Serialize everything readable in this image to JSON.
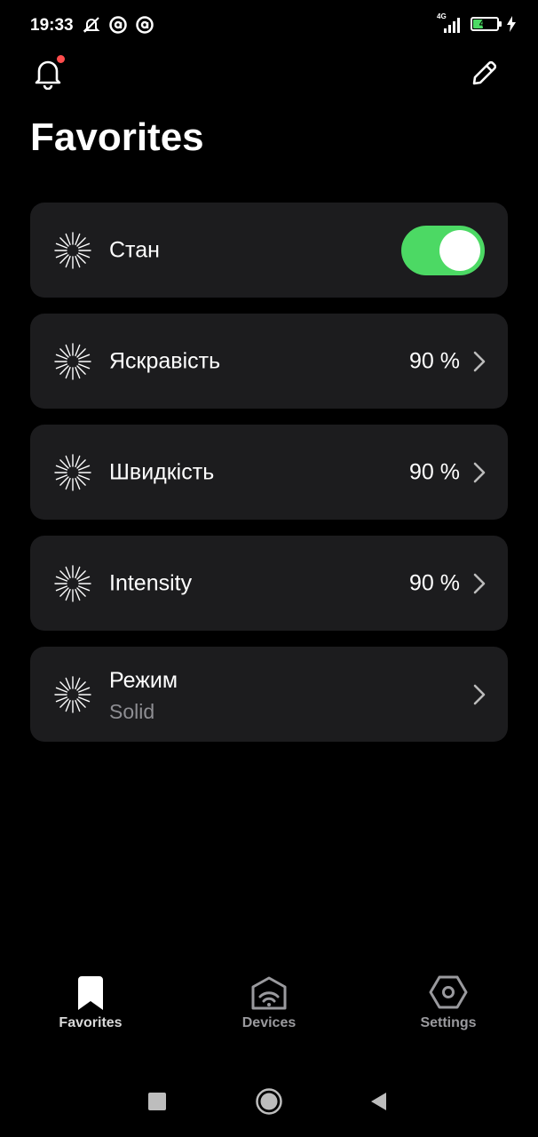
{
  "status_bar": {
    "time": "19:33",
    "network": "4G",
    "battery_level": "41",
    "battery_fill_fraction": 0.41
  },
  "header": {
    "title": "Favorites",
    "notification_icon": "bell-icon",
    "edit_icon": "pencil-icon"
  },
  "items": [
    {
      "label": "Стан",
      "type": "toggle",
      "on": true,
      "icon": "sparkle-icon"
    },
    {
      "label": "Яскравість",
      "value": "90 %",
      "icon": "sparkle-icon"
    },
    {
      "label": "Швидкість",
      "value": "90 %",
      "icon": "sparkle-icon"
    },
    {
      "label": "Intensity",
      "value": "90 %",
      "icon": "sparkle-icon"
    },
    {
      "label": "Режим",
      "sublabel": "Solid",
      "icon": "sparkle-icon"
    }
  ],
  "bottom_nav": [
    {
      "label": "Favorites",
      "icon": "bookmark-icon",
      "active": true
    },
    {
      "label": "Devices",
      "icon": "router-icon",
      "active": false
    },
    {
      "label": "Settings",
      "icon": "hexagon-gear-icon",
      "active": false
    }
  ],
  "colors": {
    "background": "#000000",
    "card": "#1c1c1e",
    "accent_green": "#4cd964",
    "notification_dot": "#ff4d4d",
    "secondary_text": "#8e8e93"
  }
}
